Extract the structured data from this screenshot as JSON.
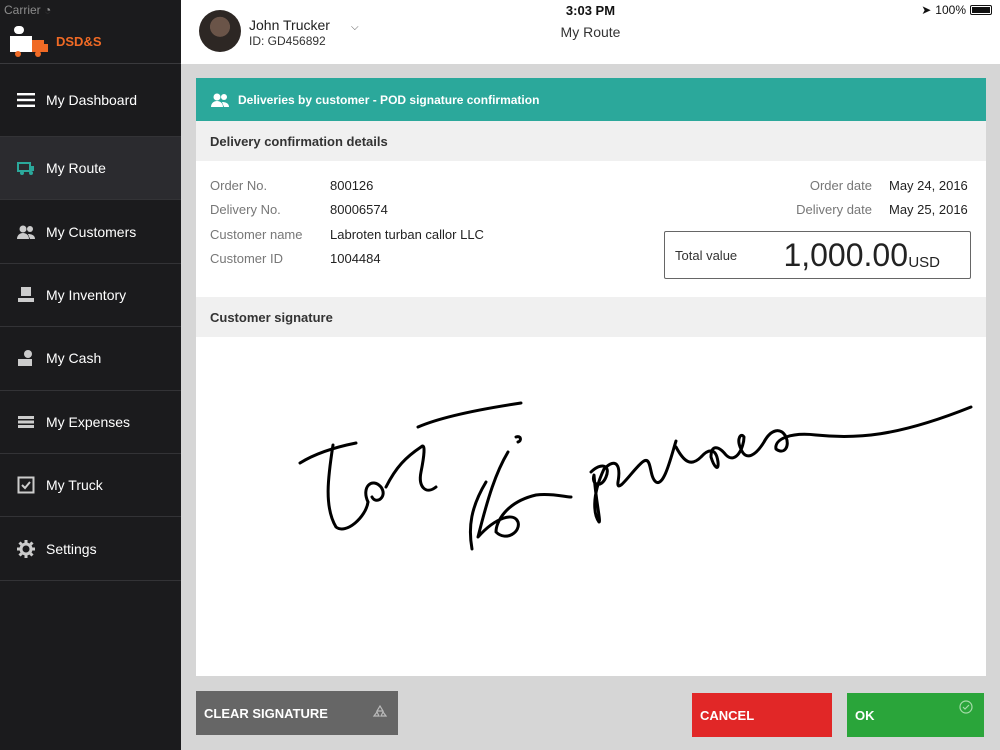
{
  "status": {
    "carrier": "Carrier",
    "time": "3:03 PM",
    "battery": "100%"
  },
  "app": {
    "logo_text": "DSD&S"
  },
  "user": {
    "name": "John Trucker",
    "id": "ID: GD456892"
  },
  "header": {
    "title": "My Route"
  },
  "sidebar": {
    "items": [
      {
        "label": "My Dashboard",
        "icon": "menu-icon"
      },
      {
        "label": "My Route",
        "icon": "route-icon",
        "active": true
      },
      {
        "label": "My Customers",
        "icon": "customers-icon"
      },
      {
        "label": "My Inventory",
        "icon": "inventory-icon"
      },
      {
        "label": "My Cash",
        "icon": "cash-icon"
      },
      {
        "label": "My Expenses",
        "icon": "expenses-icon"
      },
      {
        "label": "My Truck",
        "icon": "truck-check-icon"
      },
      {
        "label": "Settings",
        "icon": "gear-icon"
      }
    ]
  },
  "card": {
    "title": "Deliveries by customer - POD signature confirmation",
    "details_heading": "Delivery confirmation details",
    "signature_heading": "Customer signature",
    "order_no_label": "Order No.",
    "order_no": "800126",
    "delivery_no_label": "Delivery No.",
    "delivery_no": "80006574",
    "customer_name_label": "Customer name",
    "customer_name": "Labroten turban callor LLC",
    "customer_id_label": "Customer ID",
    "customer_id": "1004484",
    "order_date_label": "Order date",
    "order_date": "May 24, 2016",
    "delivery_date_label": "Delivery date",
    "delivery_date": "May 25, 2016",
    "total_label": "Total value",
    "total_value": "1,000.00",
    "currency": "USD"
  },
  "buttons": {
    "clear": "CLEAR SIGNATURE",
    "cancel": "CANCEL",
    "ok": "OK"
  },
  "colors": {
    "accent": "#2ba89b",
    "brand": "#f06a25",
    "cancel": "#e12727",
    "ok": "#2aa53a",
    "sidebar": "#1b1b1d"
  }
}
